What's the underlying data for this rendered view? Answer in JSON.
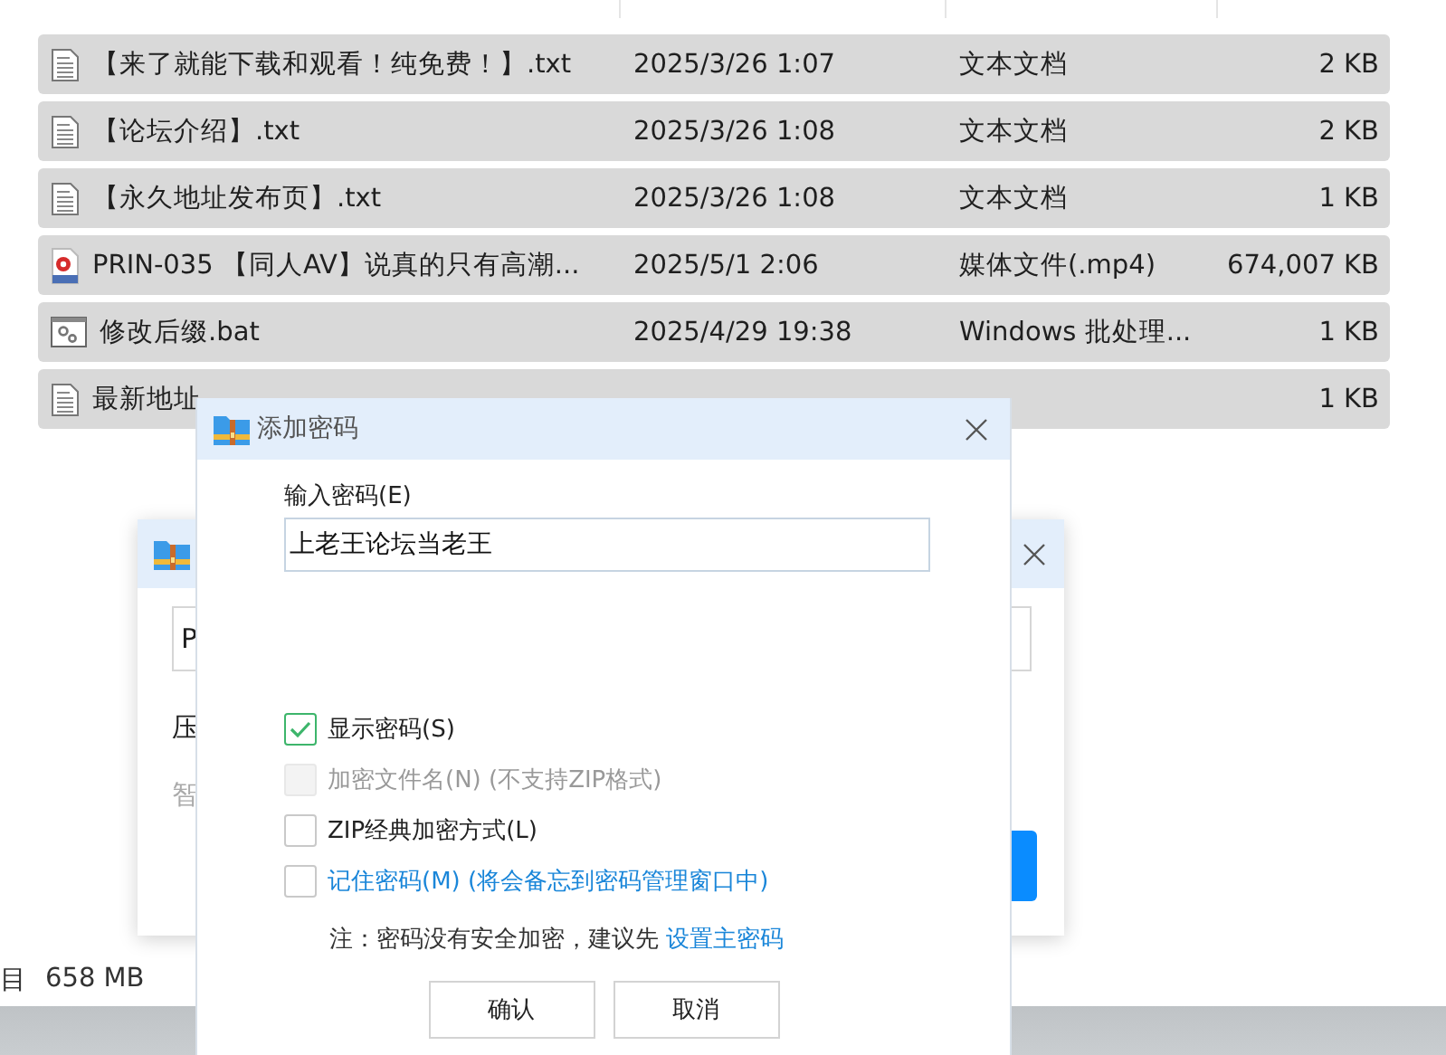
{
  "explorer": {
    "rows": [
      {
        "kind": "text",
        "name": "【来了就能下载和观看！纯免费！】.txt",
        "modified": "2025/3/26 1:07",
        "type": "文本文档",
        "size": "2 KB",
        "selected": true
      },
      {
        "kind": "text",
        "name": "【论坛介绍】.txt",
        "modified": "2025/3/26 1:08",
        "type": "文本文档",
        "size": "2 KB",
        "selected": true
      },
      {
        "kind": "text",
        "name": "【永久地址发布页】.txt",
        "modified": "2025/3/26 1:08",
        "type": "文本文档",
        "size": "1 KB",
        "selected": true
      },
      {
        "kind": "video",
        "name": "PRIN-035 【同人AV】说真的只有高潮...",
        "modified": "2025/5/1 2:06",
        "type": "媒体文件(.mp4)",
        "size": "674,007 KB",
        "selected": true
      },
      {
        "kind": "script",
        "name": "修改后缀.bat",
        "modified": "2025/4/29 19:38",
        "type": "Windows 批处理...",
        "size": "1 KB",
        "selected": true
      },
      {
        "kind": "text",
        "name": "最新地址",
        "size": "1 KB",
        "selected": true
      }
    ],
    "status_bar": {
      "count": "目",
      "size": "658 MB"
    }
  },
  "back_dialog": {
    "field_value": "P",
    "line_1": "压",
    "line_2": "智"
  },
  "dialog": {
    "title": "添加密码",
    "password_label": "输入密码(E)",
    "password_value": "上老王论坛当老王",
    "options": [
      {
        "kind": "plain",
        "label": "显示密码(S)",
        "checked": true,
        "disabled": false
      },
      {
        "kind": "plain",
        "label": "加密文件名(N) (不支持ZIP格式)",
        "checked": false,
        "disabled": true
      },
      {
        "kind": "plain",
        "label": "ZIP经典加密方式(L)",
        "checked": false,
        "disabled": false
      },
      {
        "kind": "link",
        "label": "记住密码(M) (将会备忘到密码管理窗口中)",
        "checked": false,
        "disabled": false
      }
    ],
    "note": "注：密码没有安全加密，建议先",
    "note_link": "设置主密码",
    "buttons": [
      "确认",
      "取消"
    ]
  }
}
